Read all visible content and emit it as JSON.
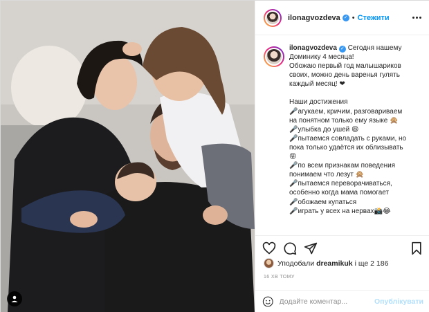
{
  "header": {
    "username": "ilonagvozdeva",
    "follow_label": "Стежити"
  },
  "caption": {
    "username": "ilonagvozdeva",
    "lines": [
      "Сегодня нашему",
      "Доминику 4 месяца!",
      "Обожаю первый год малышариков",
      "своих, можно день варенья гулять",
      "каждый месяц! ❤",
      "",
      "Наши достижения",
      "🎤агукаем, кричим, разговариваем",
      "на понятном только ему языке 🙊",
      "🎤улыбка до ушей 😆",
      "🎤пытаемся совладать с руками, но",
      "пока только удаётся их облизывать",
      "😝",
      "🎤по всем признакам поведения",
      "понимаем что лезут 🙊",
      "🎤пытаемся переворачиваться,",
      "особенно когда мама помогает",
      "🎤обожаем купаться",
      "🎤играть у всех на нервах📸😂"
    ]
  },
  "likes": {
    "prefix": "Уподобали",
    "user": "dreamikuk",
    "suffix": "і ще 2 186"
  },
  "timestamp": "16 ХВ ТОМУ",
  "comment": {
    "placeholder": "Додайте коментар...",
    "post_label": "Опублікувати"
  },
  "icons": {
    "like": "heart-icon",
    "comment": "comment-icon",
    "share": "share-icon",
    "save": "bookmark-icon",
    "more": "more-icon",
    "emoji": "emoji-icon",
    "tag": "user-tag-icon",
    "verified": "verified-badge-icon"
  },
  "colors": {
    "link": "#0095f6",
    "post_disabled": "#b2dffc",
    "muted": "#8e8e8e",
    "verified": "#3897f0"
  }
}
